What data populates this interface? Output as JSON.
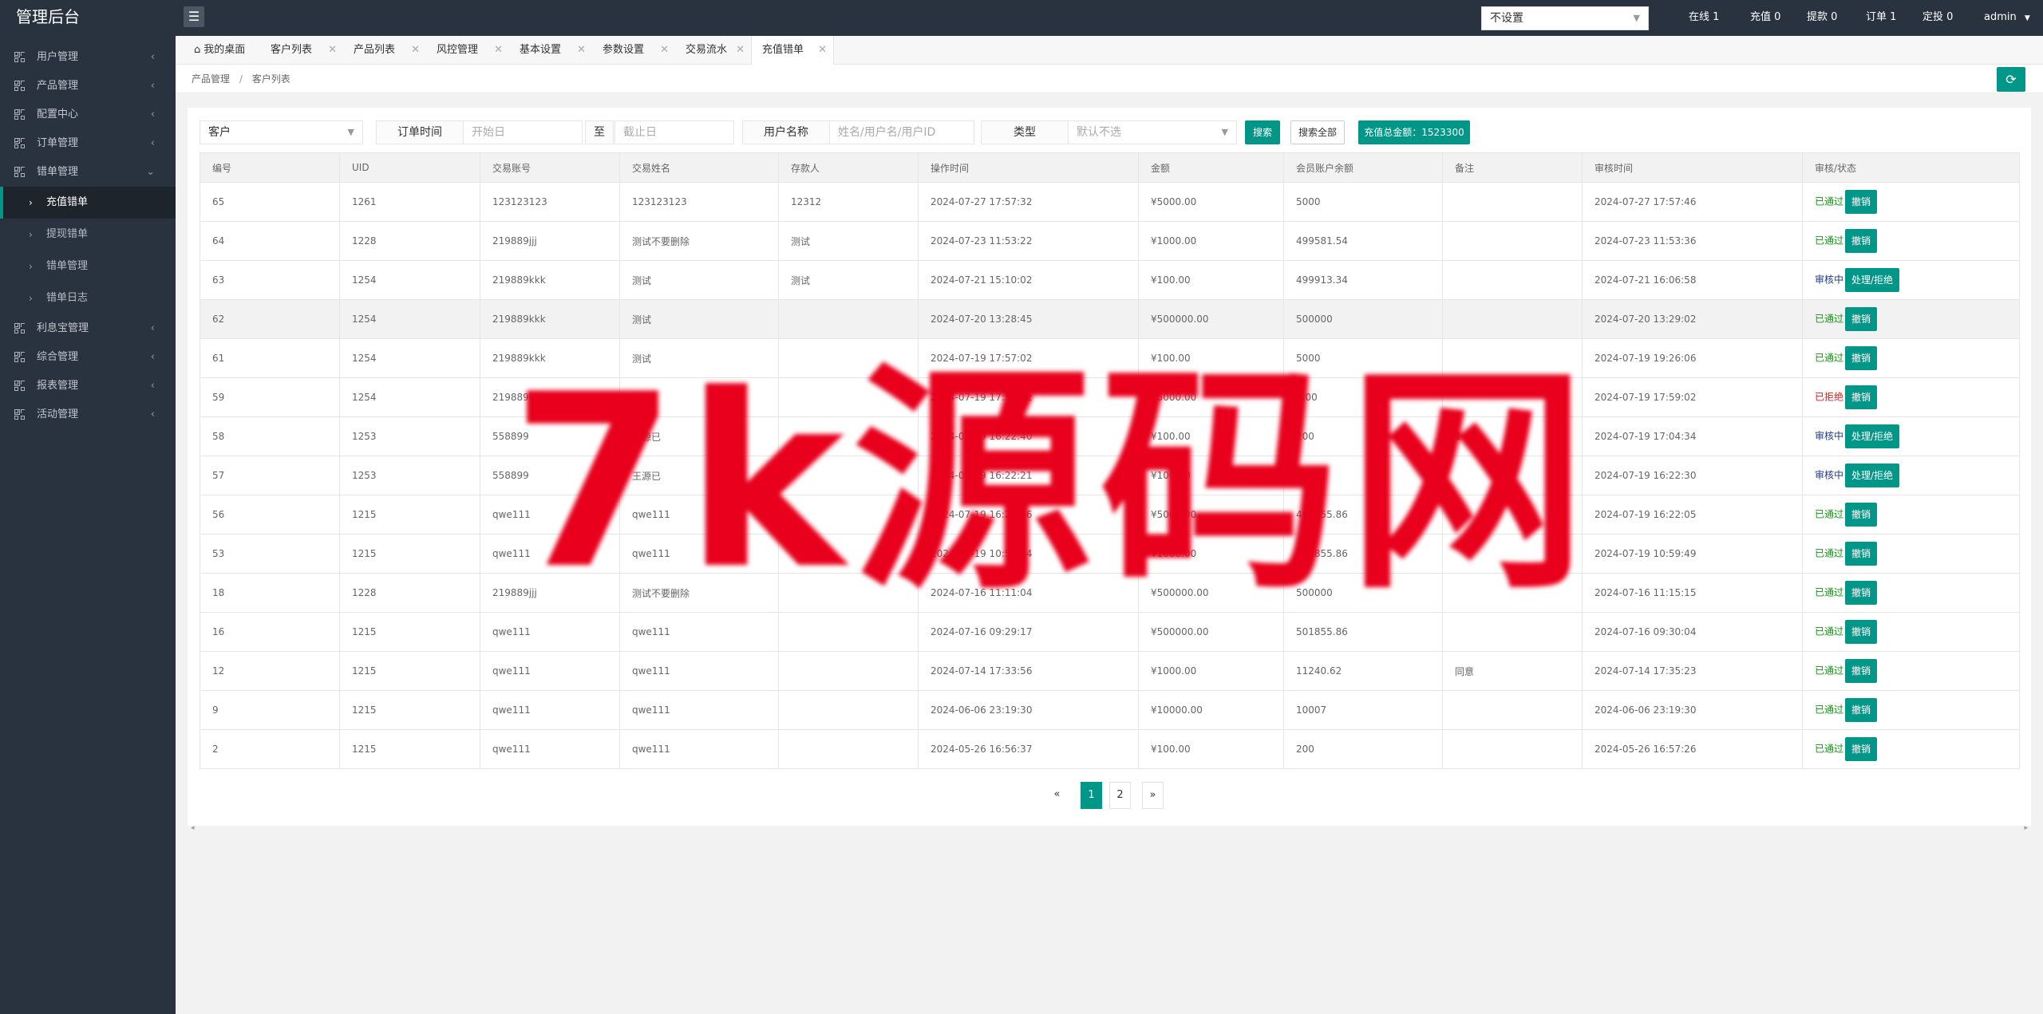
{
  "app_title": "管理后台",
  "sidebar": {
    "items": [
      {
        "label": "用户管理"
      },
      {
        "label": "产品管理"
      },
      {
        "label": "配置中心"
      },
      {
        "label": "订单管理"
      },
      {
        "label": "错单管理"
      },
      {
        "label": "利息宝管理"
      },
      {
        "label": "综合管理"
      },
      {
        "label": "报表管理"
      },
      {
        "label": "活动管理"
      }
    ],
    "subitems": [
      {
        "label": "充值错单"
      },
      {
        "label": "提现错单"
      },
      {
        "label": "错单管理"
      },
      {
        "label": "错单日志"
      }
    ]
  },
  "topbar": {
    "currency_select": "不设置",
    "online": "在线 1",
    "recharge": "充值 0",
    "withdraw": "提款 0",
    "orders": "订单 1",
    "fixed": "定投 0",
    "user": "admin"
  },
  "tabs": [
    {
      "label": "我的桌面"
    },
    {
      "label": "客户列表"
    },
    {
      "label": "产品列表"
    },
    {
      "label": "风控管理"
    },
    {
      "label": "基本设置"
    },
    {
      "label": "参数设置"
    },
    {
      "label": "交易流水"
    },
    {
      "label": "充值错单"
    }
  ],
  "breadcrumb": {
    "first": "产品管理",
    "sep": "/",
    "second": "客户列表"
  },
  "filters": {
    "customer_select": "客户",
    "order_time_label": "订单时间",
    "start_placeholder": "开始日",
    "to": "至",
    "end_placeholder": "截止日",
    "username_label": "用户名称",
    "username_placeholder": "姓名/用户名/用户ID",
    "type_label": "类型",
    "type_value": "默认不选",
    "search_button": "搜索",
    "search_all_button": "搜索全部",
    "total_label": "充值总金额：1523300"
  },
  "table": {
    "headers": [
      "编号",
      "UID",
      "交易账号",
      "交易姓名",
      "存款人",
      "操作时间",
      "金额",
      "会员账户余额",
      "备注",
      "审核时间",
      "审核/状态"
    ],
    "rows": [
      [
        "65",
        "1261",
        "123123123",
        "123123123",
        "12312",
        "2024-07-27 17:57:32",
        "¥5000.00",
        "5000",
        "",
        "2024-07-27 17:57:46",
        "已通过",
        "撤销"
      ],
      [
        "64",
        "1228",
        "219889jjj",
        "测试不要删除",
        "测试",
        "2024-07-23 11:53:22",
        "¥1000.00",
        "499581.54",
        "",
        "2024-07-23 11:53:36",
        "已通过",
        "撤销"
      ],
      [
        "63",
        "1254",
        "219889kkk",
        "测试",
        "测试",
        "2024-07-21 15:10:02",
        "¥100.00",
        "499913.34",
        "",
        "2024-07-21 16:06:58",
        "审核中",
        "处理/拒绝"
      ],
      [
        "62",
        "1254",
        "219889kkk",
        "测试",
        "",
        "2024-07-20 13:28:45",
        "¥500000.00",
        "500000",
        "",
        "2024-07-20 13:29:02",
        "已通过",
        "撤销"
      ],
      [
        "61",
        "1254",
        "219889kkk",
        "测试",
        "",
        "2024-07-19 17:57:02",
        "¥100.00",
        "5000",
        "",
        "2024-07-19 19:26:06",
        "已通过",
        "撤销"
      ],
      [
        "59",
        "1254",
        "219889kkk",
        "测试",
        "",
        "2024-07-19 17:53:52",
        "¥5000.00",
        "0.00",
        "",
        "2024-07-19 17:59:02",
        "已拒绝",
        "撤销"
      ],
      [
        "58",
        "1253",
        "558899",
        "王源已",
        "",
        "2024-07-19 16:22:40",
        "¥100.00",
        "200",
        "1",
        "2024-07-19 17:04:34",
        "审核中",
        "处理/拒绝"
      ],
      [
        "57",
        "1253",
        "558899",
        "王源已",
        "",
        "2024-07-19 16:22:21",
        "¥100.00",
        "100",
        "",
        "2024-07-19 16:22:30",
        "审核中",
        "处理/拒绝"
      ],
      [
        "56",
        "1215",
        "qwe111",
        "qwe111",
        "",
        "2024-07-19 16:21:56",
        "¥5000.00",
        "499855.86",
        "",
        "2024-07-19 16:22:05",
        "已通过",
        "撤销"
      ],
      [
        "53",
        "1215",
        "qwe111",
        "qwe111",
        "",
        "2024-07-19 10:59:34",
        "¥1000.00",
        "501855.86",
        "",
        "2024-07-19 10:59:49",
        "已通过",
        "撤销"
      ],
      [
        "18",
        "1228",
        "219889jjj",
        "测试不要删除",
        "",
        "2024-07-16 11:11:04",
        "¥500000.00",
        "500000",
        "",
        "2024-07-16 11:15:15",
        "已通过",
        "撤销"
      ],
      [
        "16",
        "1215",
        "qwe111",
        "qwe111",
        "",
        "2024-07-16 09:29:17",
        "¥500000.00",
        "501855.86",
        "",
        "2024-07-16 09:30:04",
        "已通过",
        "撤销"
      ],
      [
        "12",
        "1215",
        "qwe111",
        "qwe111",
        "",
        "2024-07-14 17:33:56",
        "¥1000.00",
        "11240.62",
        "同意",
        "2024-07-14 17:35:23",
        "已通过",
        "撤销"
      ],
      [
        "9",
        "1215",
        "qwe111",
        "qwe111",
        "",
        "2024-06-06 23:19:30",
        "¥10000.00",
        "10007",
        "",
        "2024-06-06 23:19:30",
        "已通过",
        "撤销"
      ],
      [
        "2",
        "1215",
        "qwe111",
        "qwe111",
        "",
        "2024-05-26 16:56:37",
        "¥100.00",
        "200",
        "",
        "2024-05-26 16:57:26",
        "已通过",
        "撤销"
      ]
    ]
  },
  "pagination": {
    "prev": "«",
    "pages": [
      "1",
      "2"
    ],
    "next": "»"
  },
  "watermark": "7k源码网",
  "colors": {
    "accent": "#009688",
    "sidebar": "#28333f",
    "money": "#cc0000"
  }
}
